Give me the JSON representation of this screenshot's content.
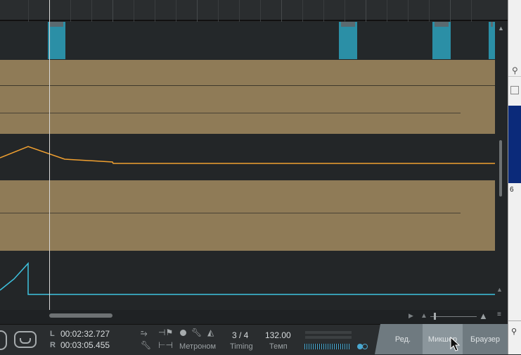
{
  "transport": {
    "loop_left_label": "L",
    "loop_left_time": "00:02:32.727",
    "loop_right_label": "R",
    "loop_right_time": "00:03:05.455",
    "metronome_label": "Метроном",
    "timing_value": "3 / 4",
    "timing_label": "Timing",
    "tempo_value": "132.00",
    "tempo_label": "Темп"
  },
  "nav": {
    "edit_label": "Ред.",
    "mixer_label": "Микшер",
    "browser_label": "Браузер"
  },
  "side_window": {
    "digit_text": "6"
  },
  "colors": {
    "clip_cyan": "#2b8fa6",
    "clip_tan": "#8f7b57",
    "automation_orange": "#f0a030",
    "automation_cyan": "#3ec3e0"
  }
}
